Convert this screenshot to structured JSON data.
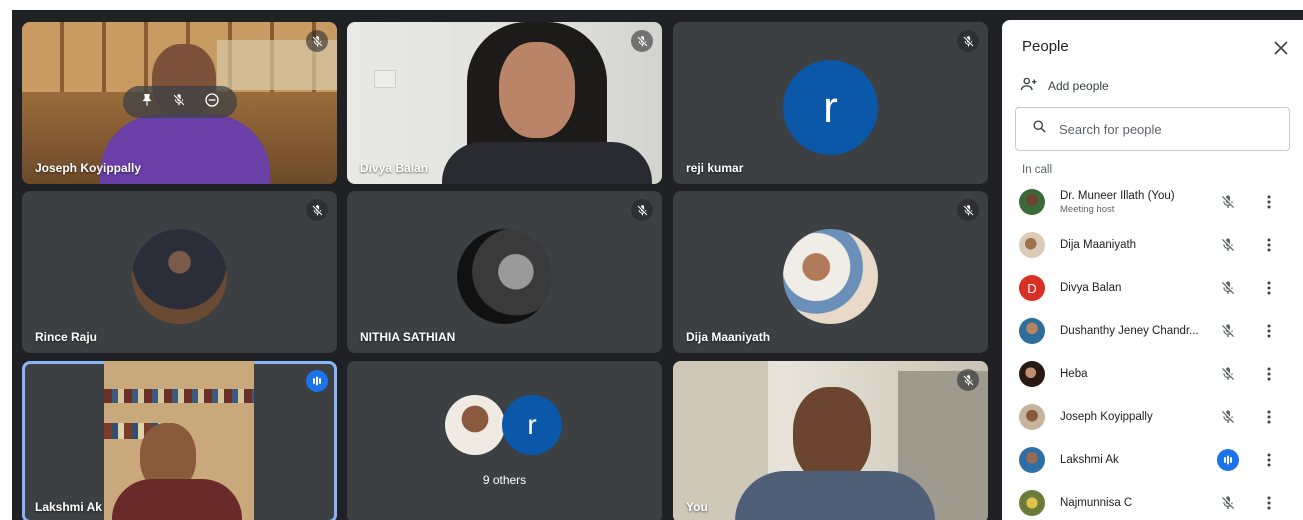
{
  "tiles": {
    "t1": {
      "name": "Joseph Koyippally"
    },
    "t2": {
      "name": "Divya Balan"
    },
    "t3": {
      "name": "reji kumar",
      "avatar_letter": "r"
    },
    "t4": {
      "name": "Rince Raju"
    },
    "t5": {
      "name": "NITHIA SATHIAN"
    },
    "t6": {
      "name": "Dija Maaniyath"
    },
    "t7": {
      "name": "Lakshmi Ak"
    },
    "t8": {
      "others_label": "9 others",
      "avatar_letter": "r"
    },
    "t9": {
      "name": "You"
    }
  },
  "panel": {
    "title": "People",
    "add_people": "Add people",
    "search_placeholder": "Search for people",
    "section_label": "In call",
    "participants": [
      {
        "name": "Dr. Muneer Illath (You)",
        "sub": "Meeting host",
        "mic": "muted"
      },
      {
        "name": "Dija Maaniyath",
        "mic": "muted"
      },
      {
        "name": "Divya Balan",
        "letter": "D",
        "mic": "muted"
      },
      {
        "name": "Dushanthy Jeney Chandr...",
        "mic": "muted"
      },
      {
        "name": "Heba",
        "mic": "muted"
      },
      {
        "name": "Joseph Koyippally",
        "mic": "muted"
      },
      {
        "name": "Lakshmi Ak",
        "mic": "speaking"
      },
      {
        "name": "Najmunnisa C",
        "mic": "muted"
      }
    ]
  },
  "colors": {
    "background": "#202124",
    "tile": "#3c4043",
    "accent_blue": "#1a73e8",
    "letter_avatar": "#0b57a8",
    "active_outline": "#8ab4f8",
    "divya_avatar": "#d93025"
  },
  "icons": [
    "mic-off-icon",
    "speaking-icon",
    "pin-icon",
    "remove-icon",
    "close-icon",
    "add-person-icon",
    "search-icon",
    "more-vert-icon"
  ]
}
